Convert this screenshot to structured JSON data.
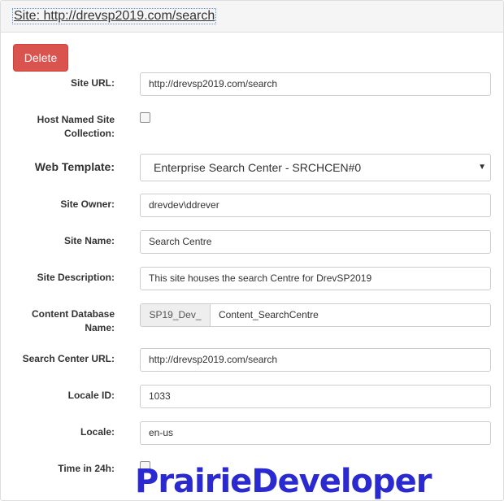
{
  "header": {
    "title": "Site: http://drevsp2019.com/search"
  },
  "actions": {
    "delete_label": "Delete"
  },
  "fields": {
    "site_url": {
      "label": "Site URL:",
      "value": "http://drevsp2019.com/search"
    },
    "host_named": {
      "label": "Host Named Site Collection:",
      "checked": false
    },
    "web_template": {
      "label": "Web Template:",
      "value": "Enterprise Search Center - SRCHCEN#0"
    },
    "site_owner": {
      "label": "Site Owner:",
      "value": "drevdev\\ddrever"
    },
    "site_name": {
      "label": "Site Name:",
      "value": "Search Centre"
    },
    "site_description": {
      "label": "Site Description:",
      "value": "This site houses the search Centre for DrevSP2019"
    },
    "content_db": {
      "label": "Content Database Name:",
      "prefix": "SP19_Dev_",
      "value": "Content_SearchCentre"
    },
    "search_center_url": {
      "label": "Search Center URL:",
      "value": "http://drevsp2019.com/search"
    },
    "locale_id": {
      "label": "Locale ID:",
      "value": "1033"
    },
    "locale": {
      "label": "Locale:",
      "value": "en-us"
    },
    "time_24h": {
      "label": "Time in 24h:",
      "checked": false
    }
  },
  "icons": {
    "select_caret": "caret-down-icon"
  },
  "colors": {
    "delete_button": "#d9534f",
    "watermark": "#2a2ad0"
  },
  "watermark": {
    "text": "PrairieDeveloper"
  }
}
